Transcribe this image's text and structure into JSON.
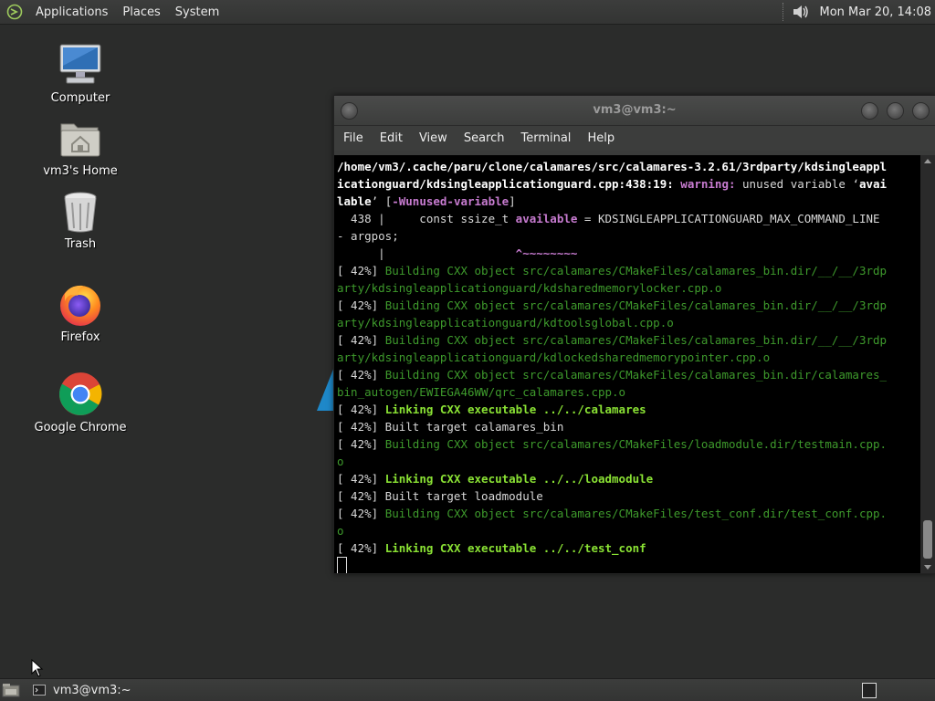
{
  "top_panel": {
    "menus": [
      "Applications",
      "Places",
      "System"
    ],
    "clock": "Mon Mar 20, 14:08"
  },
  "desktop": {
    "icons": [
      {
        "label": "Computer",
        "icon": "computer-icon"
      },
      {
        "label": "vm3's Home",
        "icon": "home-folder-icon"
      },
      {
        "label": "Trash",
        "icon": "trash-icon"
      },
      {
        "label": "Firefox",
        "icon": "firefox-icon"
      },
      {
        "label": "Google Chrome",
        "icon": "chrome-icon"
      }
    ]
  },
  "terminal": {
    "title": "vm3@vm3:~",
    "menu": [
      "File",
      "Edit",
      "View",
      "Search",
      "Terminal",
      "Help"
    ],
    "lines": {
      "l1": "/home/vm3/.cache/paru/clone/calamares/src/calamares-3.2.61/3rdparty/kdsingleappl",
      "l2a": "icationguard/kdsingleapplicationguard.cpp:438:19: ",
      "l2b": "warning: ",
      "l2c": "unused variable ‘",
      "l2d": "avai",
      "l3a": "lable",
      "l3b": "’ [",
      "l3c": "-Wunused-variable",
      "l3d": "]",
      "l4a": "  438 |     const ssize_t ",
      "l4b": "available",
      "l4c": " = KDSINGLEAPPLICATIONGUARD_MAX_COMMAND_LINE",
      "l5": "- argpos;",
      "l6a": "      |                   ",
      "l6b": "^~~~~~~~~",
      "p1": "[ 42%] ",
      "l7": "Building CXX object src/calamares/CMakeFiles/calamares_bin.dir/__/__/3rdp",
      "l8": "arty/kdsingleapplicationguard/kdsharedmemorylocker.cpp.o",
      "p2": "[ 42%] ",
      "l9": "Building CXX object src/calamares/CMakeFiles/calamares_bin.dir/__/__/3rdp",
      "l10": "arty/kdsingleapplicationguard/kdtoolsglobal.cpp.o",
      "p3": "[ 42%] ",
      "l11": "Building CXX object src/calamares/CMakeFiles/calamares_bin.dir/__/__/3rdp",
      "l12": "arty/kdsingleapplicationguard/kdlockedsharedmemorypointer.cpp.o",
      "p4": "[ 42%] ",
      "l13": "Building CXX object src/calamares/CMakeFiles/calamares_bin.dir/calamares_",
      "l14": "bin_autogen/EWIEGA46WW/qrc_calamares.cpp.o",
      "p5": "[ 42%] ",
      "l15": "Linking CXX executable ../../calamares",
      "l16": "[ 42%] Built target calamares_bin",
      "p6": "[ 42%] ",
      "l17": "Building CXX object src/calamares/CMakeFiles/loadmodule.dir/testmain.cpp.",
      "l18": "o",
      "p7": "[ 42%] ",
      "l19": "Linking CXX executable ../../loadmodule",
      "l20": "[ 42%] Built target loadmodule",
      "p8": "[ 42%] ",
      "l21": "Building CXX object src/calamares/CMakeFiles/test_conf.dir/test_conf.cpp.",
      "l22": "o",
      "p9": "[ 42%] ",
      "l23": "Linking CXX executable ../../test_conf"
    }
  },
  "bottom_panel": {
    "task_label": "vm3@vm3:~"
  },
  "colors": {
    "warning": "#c77bd0",
    "build_green": "#3e9a2c",
    "link_green": "#8ae234"
  }
}
